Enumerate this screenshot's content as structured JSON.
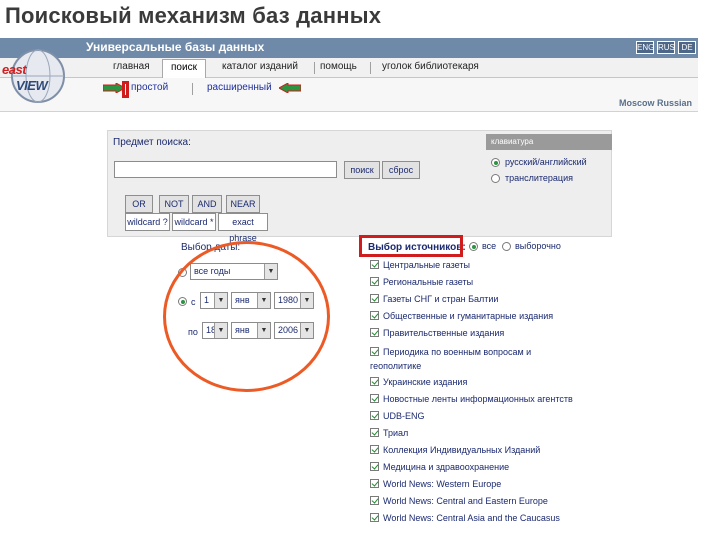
{
  "slide_title": "Поисковый механизм баз данных",
  "header": {
    "title": "Универсальные базы данных",
    "langs": [
      "ENG",
      "RUS",
      "DE"
    ],
    "logo": {
      "line1": "east",
      "line2": "VIEW"
    },
    "nav_tabs": [
      "главная",
      "поиск",
      "каталог изданий",
      "помощь",
      "уголок библиотекаря"
    ],
    "active_tab": "поиск",
    "sub_tabs": [
      "простой",
      "расширенный"
    ],
    "site_link": "Moscow Russian"
  },
  "form": {
    "subject_label": "Предмет поиска:",
    "search_value": "",
    "search_button": "поиск",
    "reset_button": "сброс",
    "operators_row1": [
      "OR",
      "NOT",
      "AND",
      "NEAR"
    ],
    "operators_row2": [
      "wildcard ?",
      "wildcard *",
      "exact phrase"
    ],
    "keyboard_header": "клавиатура",
    "keyboard_options": [
      "русский/английский",
      "транслитерация"
    ]
  },
  "date": {
    "label": "Выбор даты:",
    "all_years": "все годы",
    "from": {
      "label": "с",
      "day": "1",
      "month": "янв",
      "year": "1980"
    },
    "to": {
      "label": "по",
      "day": "18",
      "month": "янв",
      "year": "2006"
    }
  },
  "sources": {
    "label": "Выбор источников:",
    "options": [
      "все",
      "выборочно"
    ],
    "items": [
      "Центральные газеты",
      "Региональные газеты",
      "Газеты СНГ и стран Балтии",
      "Общественные и гуманитарные издания",
      "Правительственные издания",
      "Периодика по военным вопросам и геополитике",
      "Украинские издания",
      "Новостные ленты информационных агентств",
      "UDB-ENG",
      "Триал",
      "Коллекция Индивидуальных Изданий",
      "Медицина и здравоохранение",
      "World News: Western Europe",
      "World News: Central and Eastern Europe",
      "World News: Central Asia and the Caucasus"
    ]
  },
  "colors": {
    "header_bar": "#6f89a8",
    "annotation_red": "#cf1c1c",
    "annotation_orange": "#ec5a26",
    "arrow_green": "#2b9440"
  }
}
